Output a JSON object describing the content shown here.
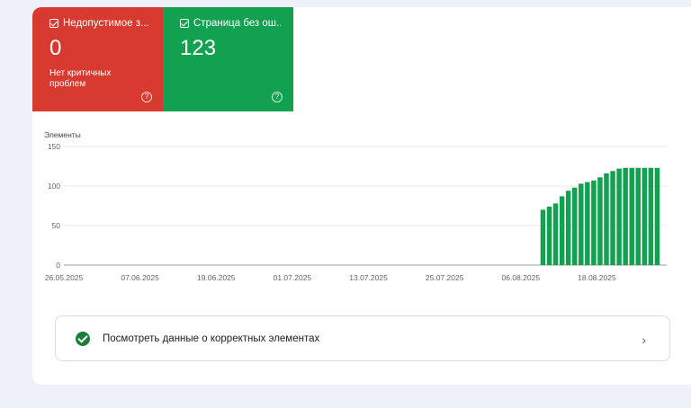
{
  "tiles": {
    "error": {
      "title": "Недопустимое з...",
      "value": "0",
      "subtitle": "Нет критичных проблем",
      "help": "?",
      "color": "#d93a30"
    },
    "valid": {
      "title": "Страница без ош...",
      "value": "123",
      "help": "?",
      "color": "#12a150"
    }
  },
  "chart_data": {
    "type": "bar",
    "ylabel": "Элементы",
    "xlabel": "",
    "title": "",
    "ylim": [
      0,
      150
    ],
    "y_ticks": [
      0,
      50,
      100,
      150
    ],
    "grid": true,
    "date_range": [
      "26.05.2025",
      "29.08.2025"
    ],
    "x_tick_labels": [
      "26.05.2025",
      "07.06.2025",
      "19.06.2025",
      "01.07.2025",
      "13.07.2025",
      "25.07.2025",
      "06.08.2025",
      "18.08.2025"
    ],
    "categories": [
      "09.08.2025",
      "10.08.2025",
      "11.08.2025",
      "12.08.2025",
      "13.08.2025",
      "14.08.2025",
      "15.08.2025",
      "16.08.2025",
      "17.08.2025",
      "18.08.2025",
      "19.08.2025",
      "20.08.2025",
      "21.08.2025",
      "22.08.2025",
      "23.08.2025",
      "24.08.2025",
      "25.08.2025",
      "26.08.2025",
      "27.08.2025"
    ],
    "values": [
      70,
      74,
      78,
      87,
      94,
      98,
      103,
      105,
      107,
      111,
      116,
      119,
      122,
      123,
      123,
      123,
      123,
      123,
      123
    ],
    "color": "#12a150"
  },
  "link_row": {
    "label": "Посмотреть данные о корректных элементах",
    "chevron": "›"
  }
}
